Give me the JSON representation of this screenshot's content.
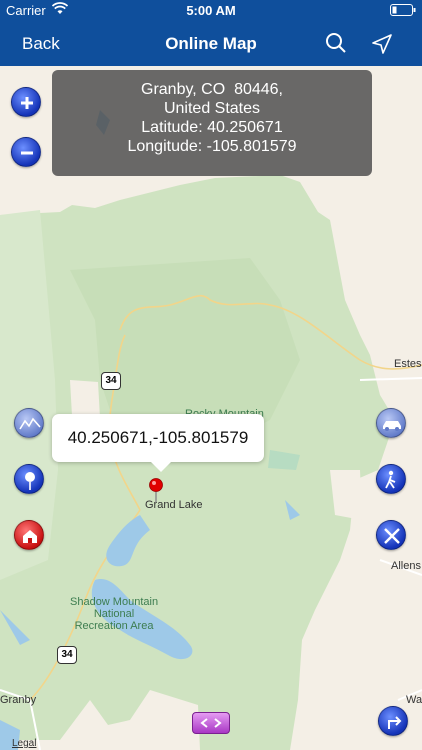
{
  "status_bar": {
    "carrier": "Carrier",
    "time": "5:00 AM"
  },
  "nav": {
    "back_label": "Back",
    "title": "Online Map"
  },
  "info": {
    "line1": "Granby, CO  80446,",
    "line2": "United States",
    "line3": "Latitude: 40.250671",
    "line4": "Longitude: -105.801579"
  },
  "callout": {
    "coords": "40.250671,-105.801579"
  },
  "map_labels": {
    "rocky_mountain": "Rocky Mountain",
    "grand_lake": "Grand Lake",
    "shadow_mountain": "Shadow Mountain\nNational\nRecreation Area",
    "estes": "Estes",
    "allens": "Allens",
    "granby": "Granby",
    "wa": "Wa",
    "hwy_34_top": "34",
    "hwy_34_bottom": "34"
  },
  "legal": "Legal",
  "colors": {
    "nav_bar": "#0f4f9c",
    "park_green": "#cfe3c1",
    "water": "#9ec9e8"
  }
}
